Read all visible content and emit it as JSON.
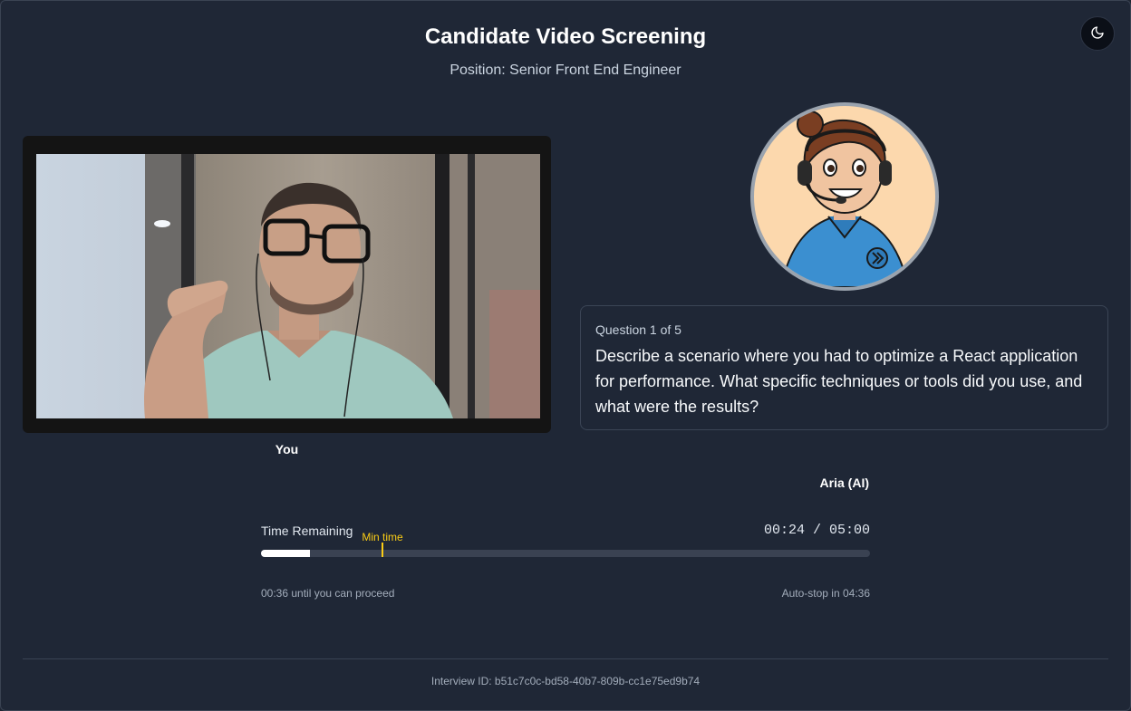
{
  "header": {
    "title": "Candidate Video Screening",
    "subtitle": "Position: Senior Front End Engineer"
  },
  "theme_toggle": {
    "icon": "moon-icon"
  },
  "candidate": {
    "label": "You"
  },
  "interviewer": {
    "label": "Aria (AI)"
  },
  "question": {
    "counter": "Question 1 of 5",
    "text": "Describe a scenario where you had to optimize a React application for performance. What specific techniques or tools did you use, and what were the results?"
  },
  "timer": {
    "label": "Time Remaining",
    "value": "00:24 / 05:00",
    "min_time_label": "Min time",
    "elapsed_seconds": 24,
    "total_seconds": 300,
    "min_seconds": 60,
    "hint_left": "00:36 until you can proceed",
    "hint_right": "Auto-stop in 04:36"
  },
  "footer": {
    "interview_id": "Interview ID: b51c7c0c-bd58-40b7-809b-cc1e75ed9b74"
  },
  "colors": {
    "accent_min": "#facc15",
    "progress_fill": "#ffffff",
    "background": "#1f2736"
  }
}
